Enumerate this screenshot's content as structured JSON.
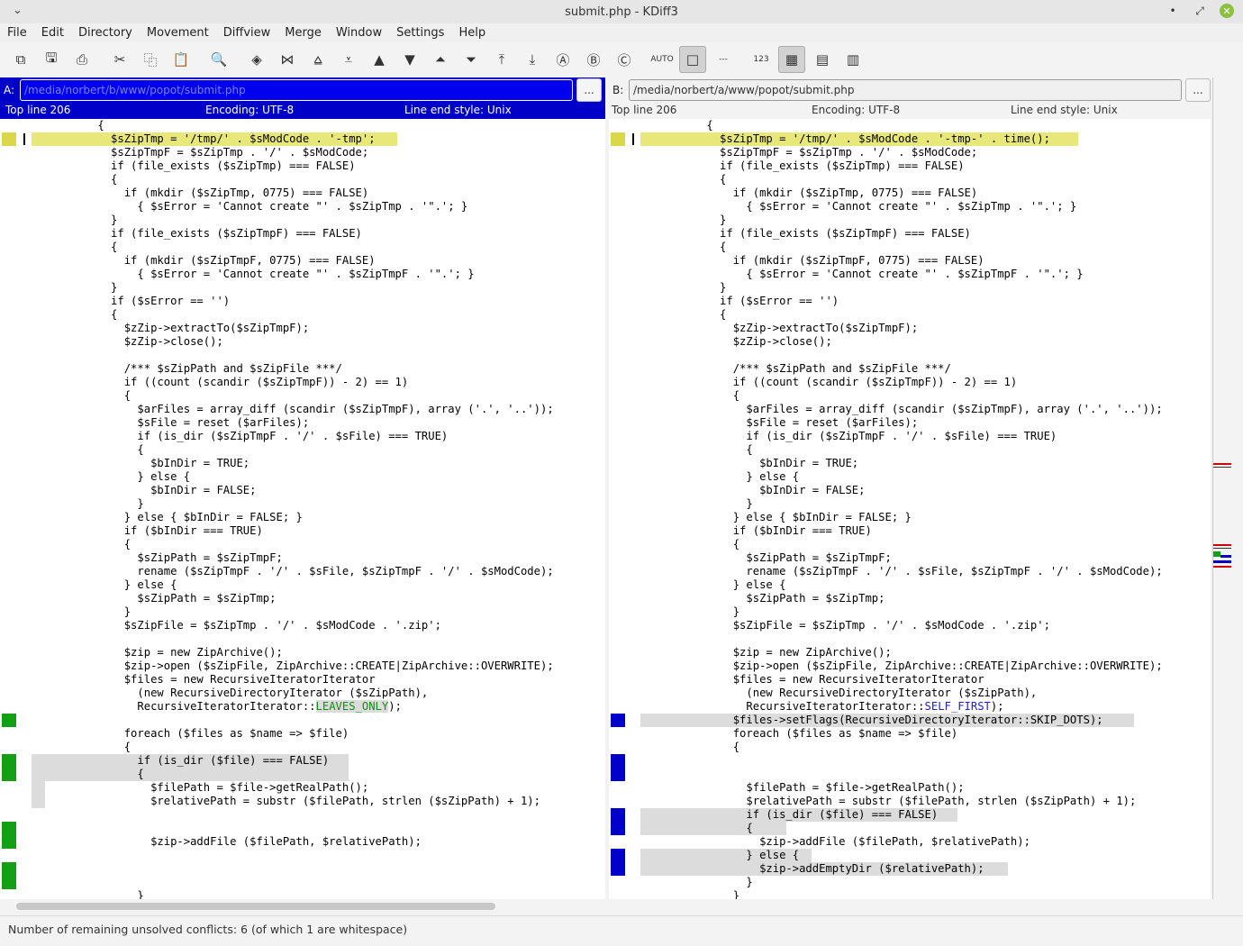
{
  "window": {
    "title": "submit.php - KDiff3",
    "menu_arrow": "⌄",
    "minimize": "•",
    "restore": "⤢",
    "close": "✕"
  },
  "menu": [
    "File",
    "Edit",
    "Directory",
    "Movement",
    "Diffview",
    "Merge",
    "Window",
    "Settings",
    "Help"
  ],
  "toolbar": [
    {
      "name": "new-window-icon",
      "glyph": "⧉"
    },
    {
      "name": "save-icon",
      "glyph": "🖫"
    },
    {
      "name": "print-icon",
      "glyph": "⎙"
    },
    {
      "name": "cut-icon",
      "glyph": "✂"
    },
    {
      "name": "copy-icon",
      "glyph": "⿻"
    },
    {
      "name": "paste-icon",
      "glyph": "📋"
    },
    {
      "name": "find-icon",
      "glyph": "🔍"
    },
    {
      "name": "go-current-icon",
      "glyph": "◈"
    },
    {
      "name": "go-top-icon",
      "glyph": "⋈"
    },
    {
      "name": "prev-delta-icon",
      "glyph": "⩠"
    },
    {
      "name": "next-delta-icon",
      "glyph": "⩡"
    },
    {
      "name": "prev-conflict-icon",
      "glyph": "▲"
    },
    {
      "name": "next-conflict-icon",
      "glyph": "▼"
    },
    {
      "name": "prev-unsolved-icon",
      "glyph": "⏶"
    },
    {
      "name": "next-unsolved-icon",
      "glyph": "⏷"
    },
    {
      "name": "go-first-icon",
      "glyph": "⤒"
    },
    {
      "name": "go-last-icon",
      "glyph": "⤓"
    },
    {
      "name": "select-a-icon",
      "glyph": "Ⓐ"
    },
    {
      "name": "select-b-icon",
      "glyph": "Ⓑ"
    },
    {
      "name": "select-c-icon",
      "glyph": "Ⓒ"
    },
    {
      "name": "auto-advance-icon",
      "glyph": "AUTO"
    },
    {
      "name": "show-whitespace-icon",
      "glyph": "□",
      "active": true
    },
    {
      "name": "show-white-space-chars-icon",
      "glyph": "---"
    },
    {
      "name": "line-numbers-icon",
      "glyph": "123"
    },
    {
      "name": "window-a-icon",
      "glyph": "▦",
      "active": true
    },
    {
      "name": "window-b-icon",
      "glyph": "▤"
    },
    {
      "name": "window-c-icon",
      "glyph": "▥"
    }
  ],
  "paneA": {
    "label": "A:",
    "path": "/media/norbert/b/www/popot/submit.php",
    "browse": "...",
    "top_line": "Top line 206",
    "encoding": "Encoding: UTF-8",
    "line_end": "Line end style: Unix"
  },
  "paneB": {
    "label": "B:",
    "path": "/media/norbert/a/www/popot/submit.php",
    "browse": "...",
    "top_line": "Top line 206",
    "encoding": "Encoding: UTF-8",
    "line_end": "Line end style: Unix"
  },
  "linesA": [
    {
      "t": "          {"
    },
    {
      "t": "            $sZipTmp = '/tmp/' . $sModCode . '-tmp';",
      "g": "yellow",
      "hl": "yellow",
      "cur": true
    },
    {
      "t": "            $sZipTmpF = $sZipTmp . '/' . $sModCode;"
    },
    {
      "t": "            if (file_exists ($sZipTmp) === FALSE)"
    },
    {
      "t": "            {"
    },
    {
      "t": "              if (mkdir ($sZipTmp, 0775) === FALSE)"
    },
    {
      "t": "                { $sError = 'Cannot create \"' . $sZipTmp . '\".'; }"
    },
    {
      "t": "            }"
    },
    {
      "t": "            if (file_exists ($sZipTmpF) === FALSE)"
    },
    {
      "t": "            {"
    },
    {
      "t": "              if (mkdir ($sZipTmpF, 0775) === FALSE)"
    },
    {
      "t": "                { $sError = 'Cannot create \"' . $sZipTmpF . '\".'; }"
    },
    {
      "t": "            }"
    },
    {
      "t": "            if ($sError == '')"
    },
    {
      "t": "            {"
    },
    {
      "t": "              $zZip->extractTo($sZipTmpF);"
    },
    {
      "t": "              $zZip->close();"
    },
    {
      "t": ""
    },
    {
      "t": "              /*** $sZipPath and $sZipFile ***/"
    },
    {
      "t": "              if ((count (scandir ($sZipTmpF)) - 2) == 1)"
    },
    {
      "t": "              {"
    },
    {
      "t": "                $arFiles = array_diff (scandir ($sZipTmpF), array ('.', '..'));"
    },
    {
      "t": "                $sFile = reset ($arFiles);"
    },
    {
      "t": "                if (is_dir ($sZipTmpF . '/' . $sFile) === TRUE)"
    },
    {
      "t": "                {"
    },
    {
      "t": "                  $bInDir = TRUE;"
    },
    {
      "t": "                } else {"
    },
    {
      "t": "                  $bInDir = FALSE;"
    },
    {
      "t": "                }"
    },
    {
      "t": "              } else { $bInDir = FALSE; }"
    },
    {
      "t": "              if ($bInDir === TRUE)"
    },
    {
      "t": "              {"
    },
    {
      "t": "                $sZipPath = $sZipTmpF;"
    },
    {
      "t": "                rename ($sZipTmpF . '/' . $sFile, $sZipTmpF . '/' . $sModCode);"
    },
    {
      "t": "              } else {"
    },
    {
      "t": "                $sZipPath = $sZipTmp;"
    },
    {
      "t": "              }"
    },
    {
      "t": "              $sZipFile = $sZipTmp . '/' . $sModCode . '.zip';"
    },
    {
      "t": ""
    },
    {
      "t": "              $zip = new ZipArchive();"
    },
    {
      "t": "              $zip->open ($sZipFile, ZipArchive::CREATE|ZipArchive::OVERWRITE);"
    },
    {
      "t": "              $files = new RecursiveIteratorIterator"
    },
    {
      "t": "                (new RecursiveDirectoryIterator ($sZipPath),"
    },
    {
      "t": "                RecursiveIteratorIterator::LEAVES_ONLY);",
      "mark": "LEAVES_ONLY",
      "mc": "green"
    },
    {
      "t": "",
      "g": "green"
    },
    {
      "t": "              foreach ($files as $name => $file)"
    },
    {
      "t": "              {"
    },
    {
      "t": "                if (is_dir ($file) === FALSE)",
      "g": "green",
      "hl": "grey",
      "c": "green"
    },
    {
      "t": "                {",
      "g": "green",
      "hl": "grey",
      "c": "green"
    },
    {
      "t": "                  $filePath = $file->getRealPath();",
      "hl": "greynarrow"
    },
    {
      "t": "                  $relativePath = substr ($filePath, strlen ($sZipPath) + 1);",
      "hl": "greynarrow"
    },
    {
      "t": ""
    },
    {
      "t": "",
      "g": "green"
    },
    {
      "t": "                  $zip->addFile ($filePath, $relativePath);",
      "g": "green"
    },
    {
      "t": ""
    },
    {
      "t": "",
      "g": "green"
    },
    {
      "t": "",
      "g": "green"
    },
    {
      "t": "                }"
    },
    {
      "t": "              }"
    }
  ],
  "linesB": [
    {
      "t": "          {"
    },
    {
      "t": "            $sZipTmp = '/tmp/' . $sModCode . '-tmp-' . time();",
      "g": "yellow",
      "hl": "yellow",
      "cur": true
    },
    {
      "t": "            $sZipTmpF = $sZipTmp . '/' . $sModCode;"
    },
    {
      "t": "            if (file_exists ($sZipTmp) === FALSE)"
    },
    {
      "t": "            {"
    },
    {
      "t": "              if (mkdir ($sZipTmp, 0775) === FALSE)"
    },
    {
      "t": "                { $sError = 'Cannot create \"' . $sZipTmp . '\".'; }"
    },
    {
      "t": "            }"
    },
    {
      "t": "            if (file_exists ($sZipTmpF) === FALSE)"
    },
    {
      "t": "            {"
    },
    {
      "t": "              if (mkdir ($sZipTmpF, 0775) === FALSE)"
    },
    {
      "t": "                { $sError = 'Cannot create \"' . $sZipTmpF . '\".'; }"
    },
    {
      "t": "            }"
    },
    {
      "t": "            if ($sError == '')"
    },
    {
      "t": "            {"
    },
    {
      "t": "              $zZip->extractTo($sZipTmpF);"
    },
    {
      "t": "              $zZip->close();"
    },
    {
      "t": ""
    },
    {
      "t": "              /*** $sZipPath and $sZipFile ***/"
    },
    {
      "t": "              if ((count (scandir ($sZipTmpF)) - 2) == 1)"
    },
    {
      "t": "              {"
    },
    {
      "t": "                $arFiles = array_diff (scandir ($sZipTmpF), array ('.', '..'));"
    },
    {
      "t": "                $sFile = reset ($arFiles);"
    },
    {
      "t": "                if (is_dir ($sZipTmpF . '/' . $sFile) === TRUE)"
    },
    {
      "t": "                {"
    },
    {
      "t": "                  $bInDir = TRUE;"
    },
    {
      "t": "                } else {"
    },
    {
      "t": "                  $bInDir = FALSE;"
    },
    {
      "t": "                }"
    },
    {
      "t": "              } else { $bInDir = FALSE; }"
    },
    {
      "t": "              if ($bInDir === TRUE)"
    },
    {
      "t": "              {"
    },
    {
      "t": "                $sZipPath = $sZipTmpF;"
    },
    {
      "t": "                rename ($sZipTmpF . '/' . $sFile, $sZipTmpF . '/' . $sModCode);"
    },
    {
      "t": "              } else {"
    },
    {
      "t": "                $sZipPath = $sZipTmp;"
    },
    {
      "t": "              }"
    },
    {
      "t": "              $sZipFile = $sZipTmp . '/' . $sModCode . '.zip';"
    },
    {
      "t": ""
    },
    {
      "t": "              $zip = new ZipArchive();"
    },
    {
      "t": "              $zip->open ($sZipFile, ZipArchive::CREATE|ZipArchive::OVERWRITE);"
    },
    {
      "t": "              $files = new RecursiveIteratorIterator"
    },
    {
      "t": "                (new RecursiveDirectoryIterator ($sZipPath),"
    },
    {
      "t": "                RecursiveIteratorIterator::SELF_FIRST);",
      "mark": "SELF_FIRST",
      "mc": "blue"
    },
    {
      "t": "              $files->setFlags(RecursiveDirectoryIterator::SKIP_DOTS);",
      "g": "blue",
      "hl": "grey",
      "c": "blue"
    },
    {
      "t": "              foreach ($files as $name => $file)"
    },
    {
      "t": "              {"
    },
    {
      "t": "",
      "g": "blue"
    },
    {
      "t": "",
      "g": "blue"
    },
    {
      "t": "                $filePath = $file->getRealPath();"
    },
    {
      "t": "                $relativePath = substr ($filePath, strlen ($sZipPath) + 1);"
    },
    {
      "t": "                if (is_dir ($file) === FALSE)",
      "g": "blue",
      "hl": "grey",
      "c": "blue"
    },
    {
      "t": "                {",
      "g": "blue",
      "hl": "grey",
      "c": "blue"
    },
    {
      "t": "                  $zip->addFile ($filePath, $relativePath);"
    },
    {
      "t": "                } else {",
      "g": "blue",
      "hl": "grey",
      "c": "blue"
    },
    {
      "t": "                  $zip->addEmptyDir ($relativePath);",
      "g": "blue",
      "hl": "grey",
      "c": "blue"
    },
    {
      "t": "                }"
    },
    {
      "t": "              }"
    }
  ],
  "status": "Number of remaining unsolved conflicts: 6 (of which 1 are whitespace)",
  "colors": {
    "yellow": "#e8e87a",
    "grey": "#dcdcdc",
    "green_text": "#148c14",
    "blue_text": "#2020d0",
    "pane_a_header": "#0000c8"
  }
}
